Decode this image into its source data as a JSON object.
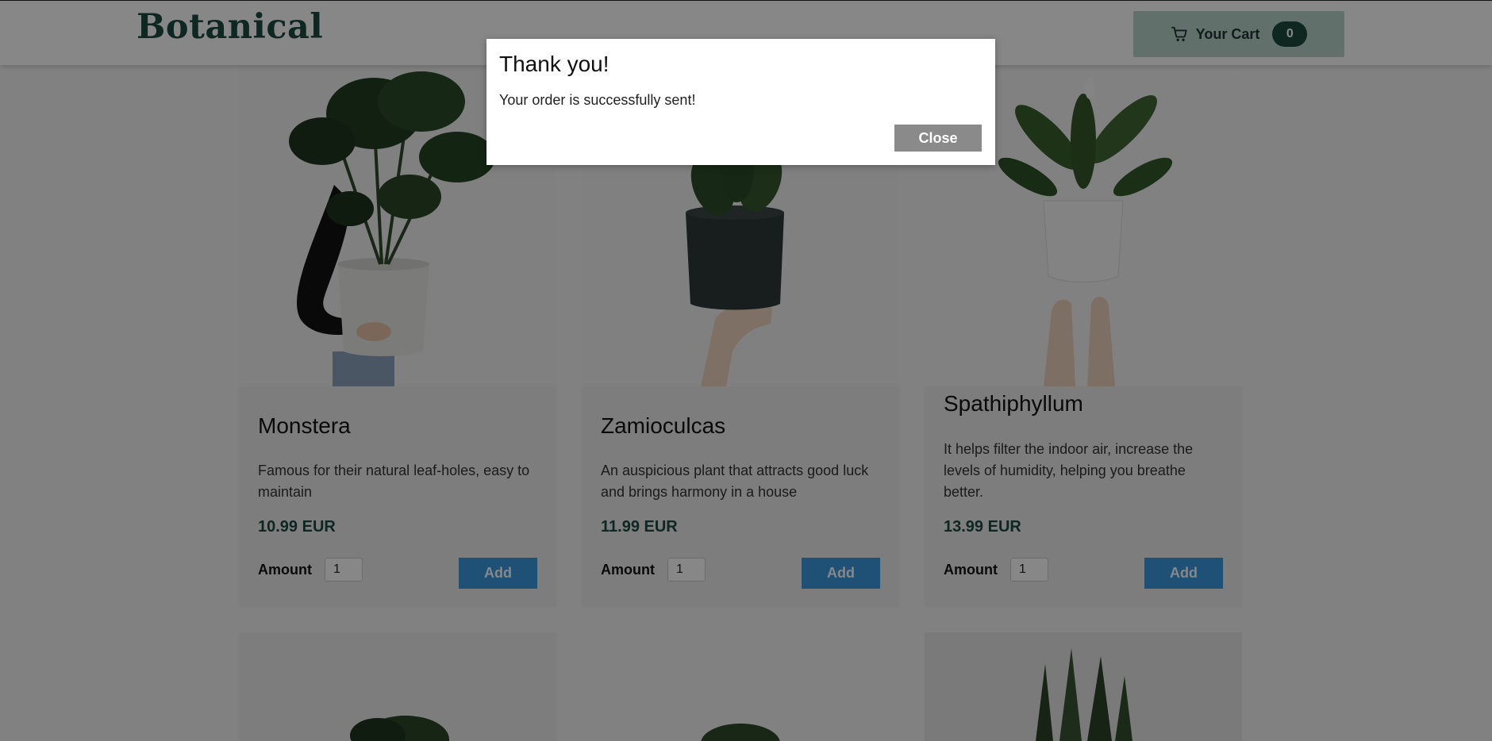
{
  "header": {
    "logo": "Botanical",
    "cart_label": "Your Cart",
    "cart_count": "0",
    "cart_icon": "cart-icon"
  },
  "products": [
    {
      "name": "Monstera",
      "description": "Famous for their natural leaf-holes, easy to maintain",
      "price": "10.99 EUR",
      "amount_label": "Amount",
      "amount_value": "1",
      "add_label": "Add"
    },
    {
      "name": "Zamioculcas",
      "description": "An auspicious plant that attracts good luck and brings harmony in a house",
      "price": "11.99 EUR",
      "amount_label": "Amount",
      "amount_value": "1",
      "add_label": "Add"
    },
    {
      "name": "Spathiphyllum",
      "description": "It helps filter the indoor air, increase the levels of humidity, helping you breathe better.",
      "price": "13.99 EUR",
      "amount_label": "Amount",
      "amount_value": "1",
      "add_label": "Add"
    }
  ],
  "modal": {
    "title": "Thank you!",
    "message": "Your order is successfully sent!",
    "close_label": "Close"
  },
  "colors": {
    "brand": "#1b4a3f",
    "cart_bg": "#b9d3cb",
    "add_button": "#3b9ae1",
    "close_button": "#8a8a8a"
  }
}
